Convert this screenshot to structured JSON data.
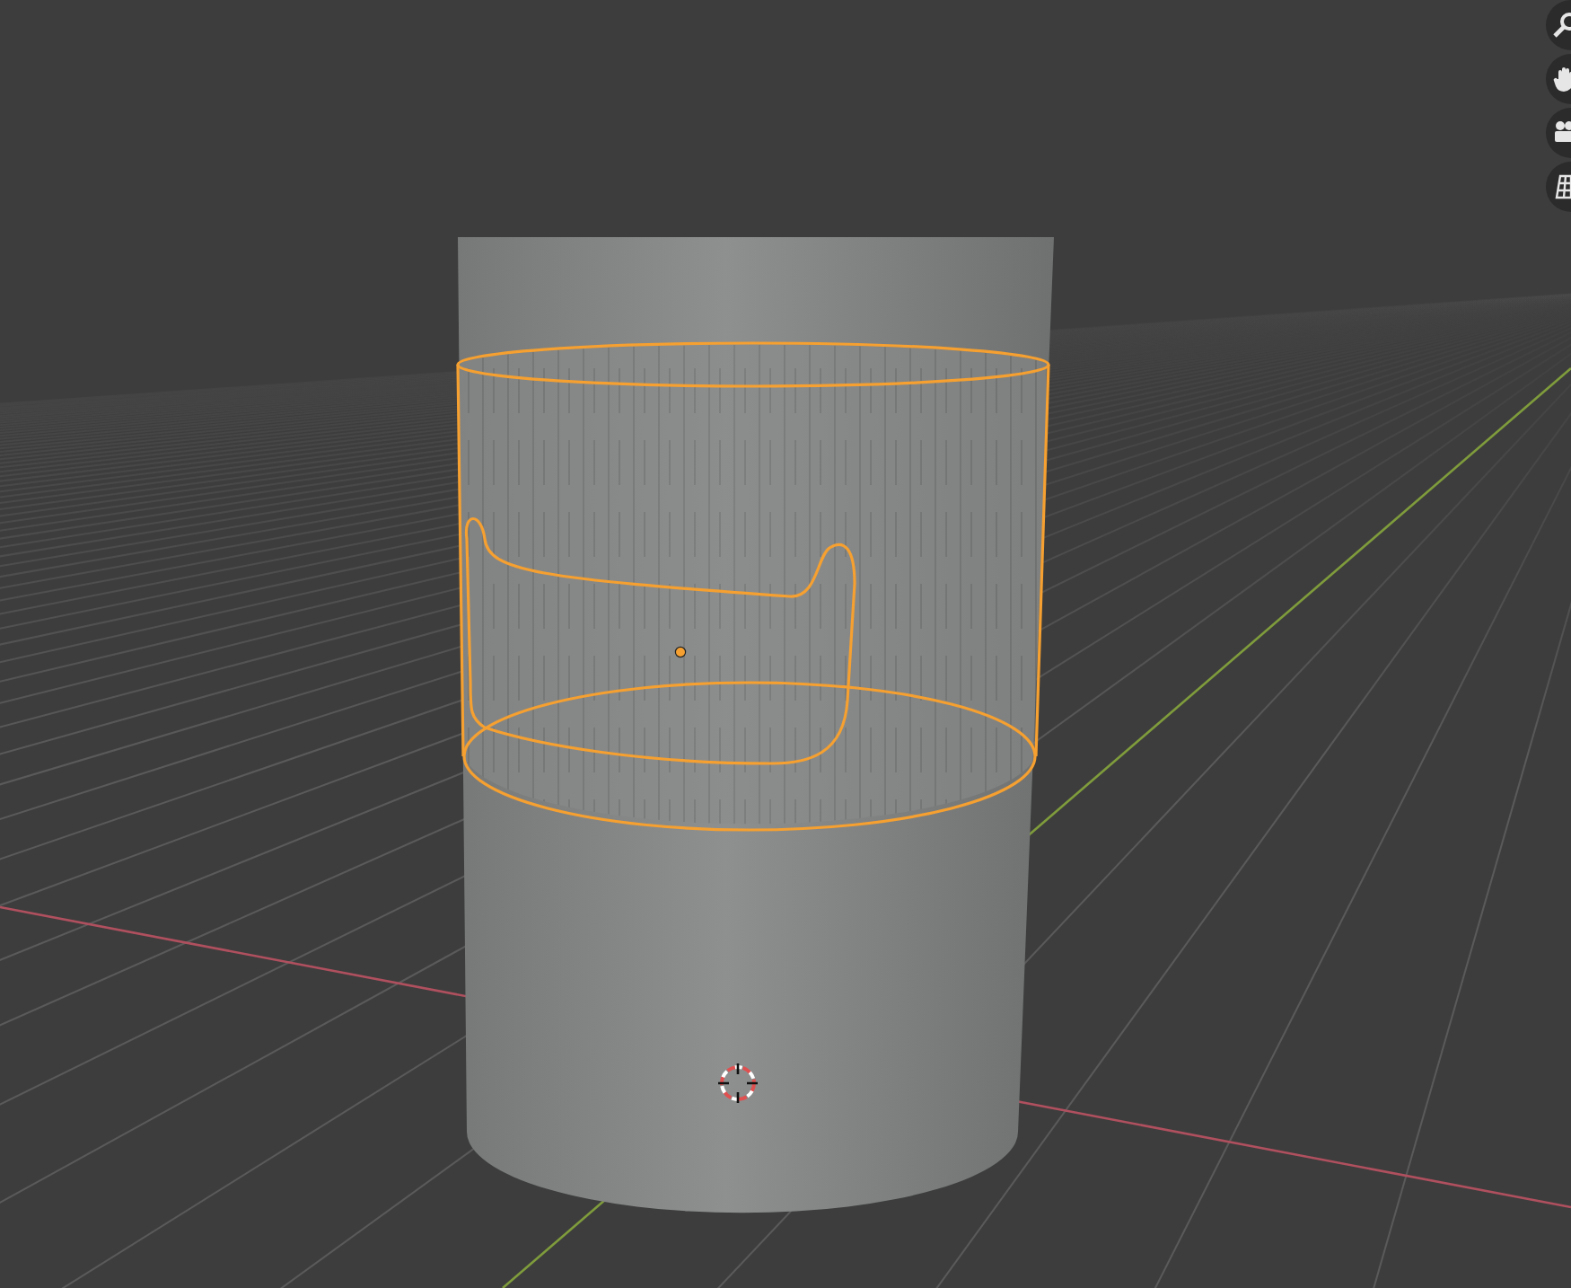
{
  "viewport": {
    "object": {
      "selected": true
    },
    "navigation_buttons": [
      {
        "kind": "zoom"
      },
      {
        "kind": "pan"
      },
      {
        "kind": "camera"
      },
      {
        "kind": "grid"
      }
    ]
  }
}
